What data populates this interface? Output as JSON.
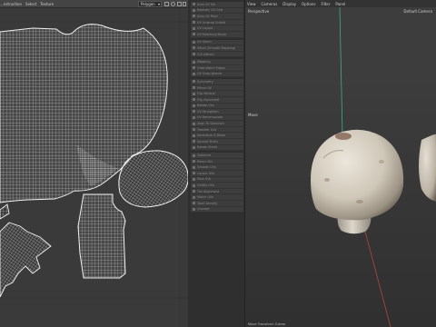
{
  "uv_editor": {
    "menus": [
      "...nstruction",
      "Select",
      "Texture"
    ],
    "mode_value": "Polygon",
    "shells": [
      "top-shell",
      "round-shell",
      "left-shell",
      "bottom-left-shell",
      "stem-shell"
    ]
  },
  "tool_panel": {
    "groups": [
      [
        "Auto UV Sel",
        "Realistic UV Grid",
        "Auto UV Pack",
        "UV Unwrap Unfold",
        "UV Layout",
        "UV Matching Brush"
      ],
      [
        "UV Stitch",
        "Stitch (Smooth Mapping)",
        "Cut (Move)"
      ],
      [
        "Mapping",
        "Grab Match Edges",
        "UV Snap Islands"
      ],
      [
        "Symmetry",
        "Mirror UV",
        "Flip Vertical",
        "Flip Horizontal",
        "Rotate UVs",
        "UV Straighten",
        "UV Rectangulate",
        "Align To Selection",
        "Transfer UVs",
        "Normalize & Relax",
        "Spread Shells",
        "Rotate Shells"
      ],
      [
        "Optimize",
        "Relax UVs",
        "Smooth UVs",
        "Layout UVs",
        "Pack UVs",
        "Gridify UVs",
        "Tile Alignment",
        "Match UVs",
        "Texel Density",
        "Checker"
      ]
    ]
  },
  "viewport": {
    "menus": [
      "View",
      "Cameras",
      "Display",
      "Options",
      "Filter",
      "Panel"
    ],
    "label_perspective": "Perspective",
    "label_camera": "Default Camera",
    "label_move": "Move",
    "status": "Move Transform Gizmo"
  }
}
